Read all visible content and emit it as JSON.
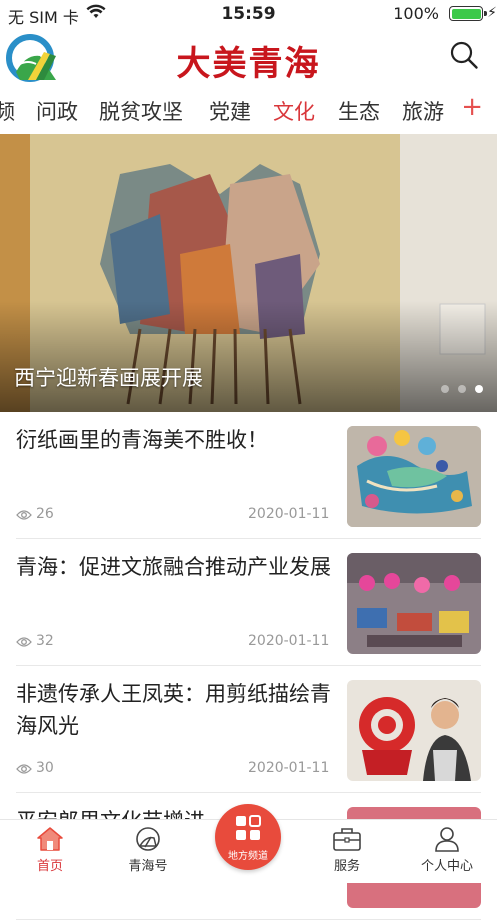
{
  "status_bar": {
    "carrier": "无 SIM 卡",
    "time": "15:59",
    "battery": "100%",
    "battery_level": 1.0
  },
  "header": {
    "brand": "大美青海"
  },
  "tabs": [
    {
      "label": "频",
      "active": false
    },
    {
      "label": "问政",
      "active": false
    },
    {
      "label": "脱贫攻坚",
      "active": false
    },
    {
      "label": "党建",
      "active": false
    },
    {
      "label": "文化",
      "active": true
    },
    {
      "label": "生态",
      "active": false
    },
    {
      "label": "旅游",
      "active": false
    }
  ],
  "tabs_add": "+",
  "banner": {
    "caption": "西宁迎新春画展开展",
    "slide_count": 3,
    "active_slide": 3
  },
  "news": [
    {
      "title": "衍纸画里的青海美不胜收！",
      "views": "26",
      "date": "2020-01-11",
      "thumb": "peacock-quilling"
    },
    {
      "title": "青海：促进文旅融合推动产业发展",
      "views": "32",
      "date": "2020-01-11",
      "thumb": "craft-market"
    },
    {
      "title": "非遗传承人王凤英：用剪纸描绘青海风光",
      "views": "30",
      "date": "2020-01-11",
      "thumb": "paper-cut"
    },
    {
      "title": "平安郎里文化节增进…情",
      "views": "",
      "date": "",
      "thumb": "partial"
    }
  ],
  "tabbar": {
    "home": "首页",
    "qinghai_hao": "青海号",
    "local_channel": "地方频道",
    "service": "服务",
    "profile": "个人中心"
  },
  "colors": {
    "accent": "#d9373b",
    "brand": "#c8161d",
    "center_button": "#e84b3c"
  }
}
